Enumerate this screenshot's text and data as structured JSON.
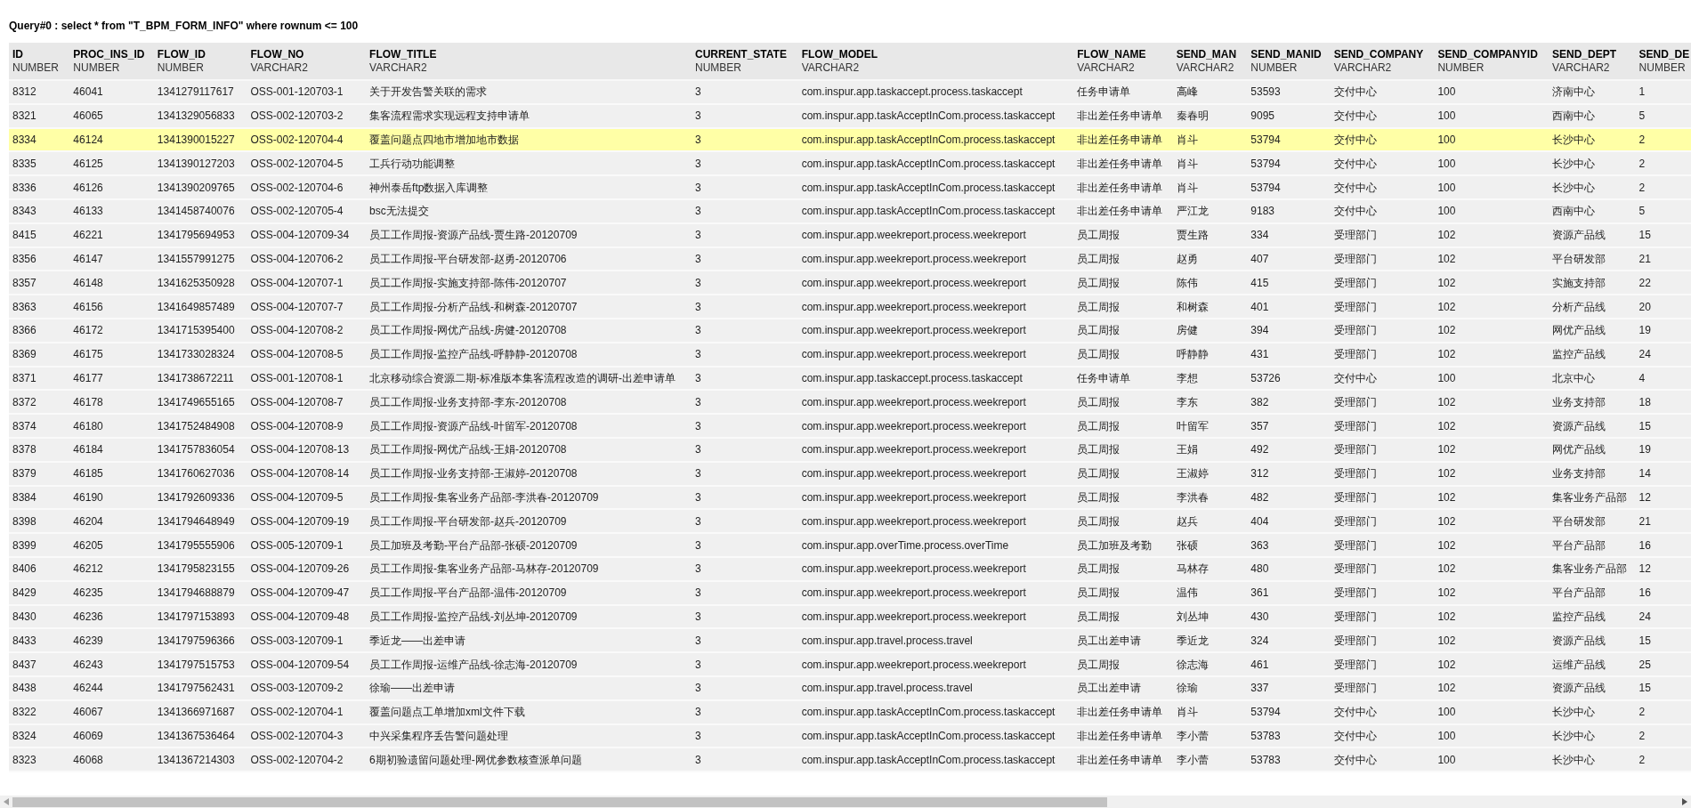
{
  "query": "Query#0 : select * from \"T_BPM_FORM_INFO\" where rownum <= 100",
  "columns": [
    {
      "name": "ID",
      "type": "NUMBER"
    },
    {
      "name": "PROC_INS_ID",
      "type": "NUMBER"
    },
    {
      "name": "FLOW_ID",
      "type": "NUMBER"
    },
    {
      "name": "FLOW_NO",
      "type": "VARCHAR2"
    },
    {
      "name": "FLOW_TITLE",
      "type": "VARCHAR2"
    },
    {
      "name": "CURRENT_STATE",
      "type": "NUMBER"
    },
    {
      "name": "FLOW_MODEL",
      "type": "VARCHAR2"
    },
    {
      "name": "FLOW_NAME",
      "type": "VARCHAR2"
    },
    {
      "name": "SEND_MAN",
      "type": "VARCHAR2"
    },
    {
      "name": "SEND_MANID",
      "type": "NUMBER"
    },
    {
      "name": "SEND_COMPANY",
      "type": "VARCHAR2"
    },
    {
      "name": "SEND_COMPANYID",
      "type": "NUMBER"
    },
    {
      "name": "SEND_DEPT",
      "type": "VARCHAR2"
    },
    {
      "name": "SEND_DE",
      "type": "NUMBER"
    }
  ],
  "rows": [
    {
      "selected": false,
      "cells": [
        "8312",
        "46041",
        "1341279117617",
        "OSS-001-120703-1",
        "关于开发告警关联的需求",
        "3",
        "com.inspur.app.taskaccept.process.taskaccept",
        "任务申请单",
        "高峰",
        "53593",
        "交付中心",
        "100",
        "济南中心",
        "1"
      ]
    },
    {
      "selected": false,
      "cells": [
        "8321",
        "46065",
        "1341329056833",
        "OSS-002-120703-2",
        "集客流程需求实现远程支持申请单",
        "3",
        "com.inspur.app.taskAcceptInCom.process.taskaccept",
        "非出差任务申请单",
        "秦春明",
        "9095",
        "交付中心",
        "100",
        "西南中心",
        "5"
      ]
    },
    {
      "selected": true,
      "cells": [
        "8334",
        "46124",
        "1341390015227",
        "OSS-002-120704-4",
        "覆盖问题点四地市增加地市数据",
        "3",
        "com.inspur.app.taskAcceptInCom.process.taskaccept",
        "非出差任务申请单",
        "肖斗",
        "53794",
        "交付中心",
        "100",
        "长沙中心",
        "2"
      ]
    },
    {
      "selected": false,
      "cells": [
        "8335",
        "46125",
        "1341390127203",
        "OSS-002-120704-5",
        "工兵行动功能调整",
        "3",
        "com.inspur.app.taskAcceptInCom.process.taskaccept",
        "非出差任务申请单",
        "肖斗",
        "53794",
        "交付中心",
        "100",
        "长沙中心",
        "2"
      ]
    },
    {
      "selected": false,
      "cells": [
        "8336",
        "46126",
        "1341390209765",
        "OSS-002-120704-6",
        "神州泰岳ftp数据入库调整",
        "3",
        "com.inspur.app.taskAcceptInCom.process.taskaccept",
        "非出差任务申请单",
        "肖斗",
        "53794",
        "交付中心",
        "100",
        "长沙中心",
        "2"
      ]
    },
    {
      "selected": false,
      "cells": [
        "8343",
        "46133",
        "1341458740076",
        "OSS-002-120705-4",
        "bsc无法提交",
        "3",
        "com.inspur.app.taskAcceptInCom.process.taskaccept",
        "非出差任务申请单",
        "严江龙",
        "9183",
        "交付中心",
        "100",
        "西南中心",
        "5"
      ]
    },
    {
      "selected": false,
      "cells": [
        "8415",
        "46221",
        "1341795694953",
        "OSS-004-120709-34",
        "员工工作周报-资源产品线-贾生路-20120709",
        "3",
        "com.inspur.app.weekreport.process.weekreport",
        "员工周报",
        "贾生路",
        "334",
        "受理部门",
        "102",
        "资源产品线",
        "15"
      ]
    },
    {
      "selected": false,
      "cells": [
        "8356",
        "46147",
        "1341557991275",
        "OSS-004-120706-2",
        "员工工作周报-平台研发部-赵勇-20120706",
        "3",
        "com.inspur.app.weekreport.process.weekreport",
        "员工周报",
        "赵勇",
        "407",
        "受理部门",
        "102",
        "平台研发部",
        "21"
      ]
    },
    {
      "selected": false,
      "cells": [
        "8357",
        "46148",
        "1341625350928",
        "OSS-004-120707-1",
        "员工工作周报-实施支持部-陈伟-20120707",
        "3",
        "com.inspur.app.weekreport.process.weekreport",
        "员工周报",
        "陈伟",
        "415",
        "受理部门",
        "102",
        "实施支持部",
        "22"
      ]
    },
    {
      "selected": false,
      "cells": [
        "8363",
        "46156",
        "1341649857489",
        "OSS-004-120707-7",
        "员工工作周报-分析产品线-和树森-20120707",
        "3",
        "com.inspur.app.weekreport.process.weekreport",
        "员工周报",
        "和树森",
        "401",
        "受理部门",
        "102",
        "分析产品线",
        "20"
      ]
    },
    {
      "selected": false,
      "cells": [
        "8366",
        "46172",
        "1341715395400",
        "OSS-004-120708-2",
        "员工工作周报-网优产品线-房健-20120708",
        "3",
        "com.inspur.app.weekreport.process.weekreport",
        "员工周报",
        "房健",
        "394",
        "受理部门",
        "102",
        "网优产品线",
        "19"
      ]
    },
    {
      "selected": false,
      "cells": [
        "8369",
        "46175",
        "1341733028324",
        "OSS-004-120708-5",
        "员工工作周报-监控产品线-呼静静-20120708",
        "3",
        "com.inspur.app.weekreport.process.weekreport",
        "员工周报",
        "呼静静",
        "431",
        "受理部门",
        "102",
        "监控产品线",
        "24"
      ]
    },
    {
      "selected": false,
      "cells": [
        "8371",
        "46177",
        "1341738672211",
        "OSS-001-120708-1",
        "北京移动综合资源二期-标准版本集客流程改造的调研-出差申请单",
        "3",
        "com.inspur.app.taskaccept.process.taskaccept",
        "任务申请单",
        "李想",
        "53726",
        "交付中心",
        "100",
        "北京中心",
        "4"
      ]
    },
    {
      "selected": false,
      "cells": [
        "8372",
        "46178",
        "1341749655165",
        "OSS-004-120708-7",
        "员工工作周报-业务支持部-李东-20120708",
        "3",
        "com.inspur.app.weekreport.process.weekreport",
        "员工周报",
        "李东",
        "382",
        "受理部门",
        "102",
        "业务支持部",
        "18"
      ]
    },
    {
      "selected": false,
      "cells": [
        "8374",
        "46180",
        "1341752484908",
        "OSS-004-120708-9",
        "员工工作周报-资源产品线-叶留军-20120708",
        "3",
        "com.inspur.app.weekreport.process.weekreport",
        "员工周报",
        "叶留军",
        "357",
        "受理部门",
        "102",
        "资源产品线",
        "15"
      ]
    },
    {
      "selected": false,
      "cells": [
        "8378",
        "46184",
        "1341757836054",
        "OSS-004-120708-13",
        "员工工作周报-网优产品线-王娟-20120708",
        "3",
        "com.inspur.app.weekreport.process.weekreport",
        "员工周报",
        "王娟",
        "492",
        "受理部门",
        "102",
        "网优产品线",
        "19"
      ]
    },
    {
      "selected": false,
      "cells": [
        "8379",
        "46185",
        "1341760627036",
        "OSS-004-120708-14",
        "员工工作周报-业务支持部-王淑婷-20120708",
        "3",
        "com.inspur.app.weekreport.process.weekreport",
        "员工周报",
        "王淑婷",
        "312",
        "受理部门",
        "102",
        "业务支持部",
        "14"
      ]
    },
    {
      "selected": false,
      "cells": [
        "8384",
        "46190",
        "1341792609336",
        "OSS-004-120709-5",
        "员工工作周报-集客业务产品部-李洪春-20120709",
        "3",
        "com.inspur.app.weekreport.process.weekreport",
        "员工周报",
        "李洪春",
        "482",
        "受理部门",
        "102",
        "集客业务产品部",
        "12"
      ]
    },
    {
      "selected": false,
      "cells": [
        "8398",
        "46204",
        "1341794648949",
        "OSS-004-120709-19",
        "员工工作周报-平台研发部-赵兵-20120709",
        "3",
        "com.inspur.app.weekreport.process.weekreport",
        "员工周报",
        "赵兵",
        "404",
        "受理部门",
        "102",
        "平台研发部",
        "21"
      ]
    },
    {
      "selected": false,
      "cells": [
        "8399",
        "46205",
        "1341795555906",
        "OSS-005-120709-1",
        "员工加班及考勤-平台产品部-张硕-20120709",
        "3",
        "com.inspur.app.overTime.process.overTime",
        "员工加班及考勤",
        "张硕",
        "363",
        "受理部门",
        "102",
        "平台产品部",
        "16"
      ]
    },
    {
      "selected": false,
      "cells": [
        "8406",
        "46212",
        "1341795823155",
        "OSS-004-120709-26",
        "员工工作周报-集客业务产品部-马林存-20120709",
        "3",
        "com.inspur.app.weekreport.process.weekreport",
        "员工周报",
        "马林存",
        "480",
        "受理部门",
        "102",
        "集客业务产品部",
        "12"
      ]
    },
    {
      "selected": false,
      "cells": [
        "8429",
        "46235",
        "1341794688879",
        "OSS-004-120709-47",
        "员工工作周报-平台产品部-温伟-20120709",
        "3",
        "com.inspur.app.weekreport.process.weekreport",
        "员工周报",
        "温伟",
        "361",
        "受理部门",
        "102",
        "平台产品部",
        "16"
      ]
    },
    {
      "selected": false,
      "cells": [
        "8430",
        "46236",
        "1341797153893",
        "OSS-004-120709-48",
        "员工工作周报-监控产品线-刘丛坤-20120709",
        "3",
        "com.inspur.app.weekreport.process.weekreport",
        "员工周报",
        "刘丛坤",
        "430",
        "受理部门",
        "102",
        "监控产品线",
        "24"
      ]
    },
    {
      "selected": false,
      "cells": [
        "8433",
        "46239",
        "1341797596366",
        "OSS-003-120709-1",
        "季近龙——出差申请",
        "3",
        "com.inspur.app.travel.process.travel",
        "员工出差申请",
        "季近龙",
        "324",
        "受理部门",
        "102",
        "资源产品线",
        "15"
      ]
    },
    {
      "selected": false,
      "cells": [
        "8437",
        "46243",
        "1341797515753",
        "OSS-004-120709-54",
        "员工工作周报-运维产品线-徐志海-20120709",
        "3",
        "com.inspur.app.weekreport.process.weekreport",
        "员工周报",
        "徐志海",
        "461",
        "受理部门",
        "102",
        "运维产品线",
        "25"
      ]
    },
    {
      "selected": false,
      "cells": [
        "8438",
        "46244",
        "1341797562431",
        "OSS-003-120709-2",
        "徐瑜——出差申请",
        "3",
        "com.inspur.app.travel.process.travel",
        "员工出差申请",
        "徐瑜",
        "337",
        "受理部门",
        "102",
        "资源产品线",
        "15"
      ]
    },
    {
      "selected": false,
      "cells": [
        "8322",
        "46067",
        "1341366971687",
        "OSS-002-120704-1",
        "覆盖问题点工单增加xml文件下载",
        "3",
        "com.inspur.app.taskAcceptInCom.process.taskaccept",
        "非出差任务申请单",
        "肖斗",
        "53794",
        "交付中心",
        "100",
        "长沙中心",
        "2"
      ]
    },
    {
      "selected": false,
      "cells": [
        "8324",
        "46069",
        "1341367536464",
        "OSS-002-120704-3",
        "中兴采集程序丢告警问题处理",
        "3",
        "com.inspur.app.taskAcceptInCom.process.taskaccept",
        "非出差任务申请单",
        "李小蕾",
        "53783",
        "交付中心",
        "100",
        "长沙中心",
        "2"
      ]
    },
    {
      "selected": false,
      "cells": [
        "8323",
        "46068",
        "1341367214303",
        "OSS-002-120704-2",
        "6期初验遗留问题处理-网优参数核查派单问题",
        "3",
        "com.inspur.app.taskAcceptInCom.process.taskaccept",
        "非出差任务申请单",
        "李小蕾",
        "53783",
        "交付中心",
        "100",
        "长沙中心",
        "2"
      ]
    }
  ]
}
